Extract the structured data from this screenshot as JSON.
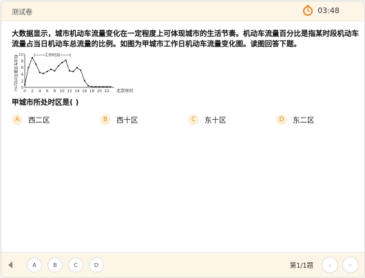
{
  "header": {
    "title": "测试卷",
    "timer": "03:48",
    "timer_icon": "stopwatch-icon",
    "accent": "#e8892c"
  },
  "question": {
    "text": "大数据显示，城市机动车流量变化在一定程度上可体现城市的生活节奏。机动车流量百分比是指某时段机动车流量占当日机动车总流量的比例。如图为甲城市工作日机动车流量变化图。读图回答下题。",
    "sub": "甲城市所处时区是(   )"
  },
  "options": [
    {
      "letter": "A",
      "text": "西二区"
    },
    {
      "letter": "B",
      "text": "西十区"
    },
    {
      "letter": "C",
      "text": "东十区"
    },
    {
      "letter": "D",
      "text": "东二区"
    }
  ],
  "footer": {
    "nav": [
      "A",
      "B",
      "C",
      "D"
    ],
    "page": "第1/1题",
    "prev_icon": "chevron-left-icon",
    "next_icon": "chevron-down-icon"
  },
  "chart_data": {
    "type": "line",
    "ylabel": "机动车流量百分比(%)",
    "xlabel": "北京时间",
    "annotation": "工作时间",
    "ylim": [
      0,
      10
    ],
    "xlim": [
      0,
      24
    ],
    "yticks": [
      "0",
      "2",
      "4",
      "6",
      "8",
      "10"
    ],
    "xticks": [
      "0",
      "2",
      "4",
      "6",
      "8",
      "10",
      "12",
      "14",
      "16",
      "18",
      "20",
      "22"
    ],
    "x": [
      0,
      1,
      2,
      3,
      4,
      5,
      6,
      7,
      8,
      9,
      10,
      11,
      12,
      13,
      14,
      15,
      16,
      17,
      18,
      19,
      20,
      21,
      22,
      23
    ],
    "values": [
      0.8,
      6,
      9,
      7,
      4.5,
      4.2,
      4.8,
      5.5,
      5,
      6.5,
      7.5,
      8.2,
      5,
      4.8,
      6,
      5.2,
      2,
      0.5,
      0.2,
      0.2,
      0.2,
      0.2,
      0.2,
      0.2
    ]
  }
}
